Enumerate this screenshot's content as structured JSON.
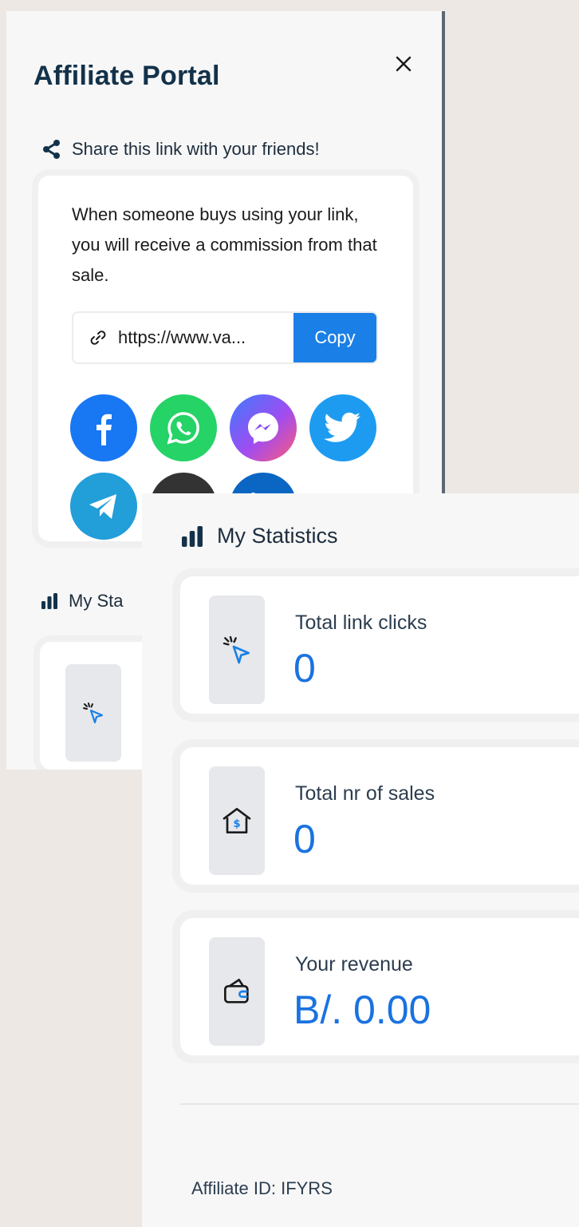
{
  "portal": {
    "title": "Affiliate Portal",
    "close_icon": "close-icon",
    "share_heading": "Share this link with your friends!",
    "share_description": "When someone buys using your link, you will receive a commission from that sale.",
    "link_value": "https://www.va...",
    "copy_label": "Copy",
    "social_buttons": [
      {
        "name": "facebook",
        "color": "#1877f2"
      },
      {
        "name": "whatsapp",
        "color": "#25d366"
      },
      {
        "name": "messenger",
        "color": "#a04cf0"
      },
      {
        "name": "twitter",
        "color": "#1d9bf0"
      },
      {
        "name": "telegram",
        "color": "#229ed9"
      },
      {
        "name": "email",
        "color": "#333333"
      },
      {
        "name": "linkedin",
        "color": "#0a66c2"
      }
    ],
    "stats_heading_partial": "My Sta"
  },
  "stats": {
    "heading": "My Statistics",
    "cards": [
      {
        "label": "Total link clicks",
        "value": "0",
        "icon": "cursor-click-icon"
      },
      {
        "label": "Total nr of sales",
        "value": "0",
        "icon": "house-dollar-icon"
      },
      {
        "label": "Your revenue",
        "value": "B/. 0.00",
        "icon": "wallet-icon"
      }
    ],
    "affiliate_id": "Affiliate ID: IFYRS"
  },
  "colors": {
    "accent": "#1a7fe6",
    "value_text": "#1a72e0",
    "title": "#13324a",
    "background": "#ede8e4"
  }
}
